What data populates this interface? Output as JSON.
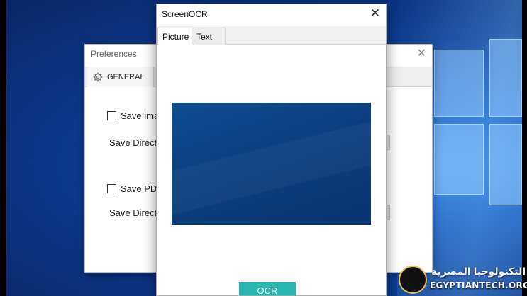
{
  "preferences": {
    "title": "Preferences",
    "close_glyph": "✕",
    "tab": {
      "label": "GENERAL",
      "icon": "gear-icon"
    },
    "options": [
      {
        "label": "Save ima",
        "checked": false
      },
      {
        "label": "Save PDI",
        "checked": false
      }
    ],
    "directories": [
      {
        "label": "Save Direct"
      },
      {
        "label": "Save Direct"
      }
    ]
  },
  "screenocr": {
    "title": "ScreenOCR",
    "close_glyph": "✕",
    "tabs": [
      {
        "label": "Picture",
        "active": true
      },
      {
        "label": "Text",
        "active": false
      }
    ],
    "ocr_button_label": "OCR",
    "ocr_button_color": "#2ab7b1"
  },
  "watermark": {
    "arabic": "التكنولوجيا المصرية",
    "latin": "EGYPTIANTECH.ORG"
  },
  "colors": {
    "desktop_blue": "#0d3b8f",
    "picture_blue": "#0c3f80"
  }
}
